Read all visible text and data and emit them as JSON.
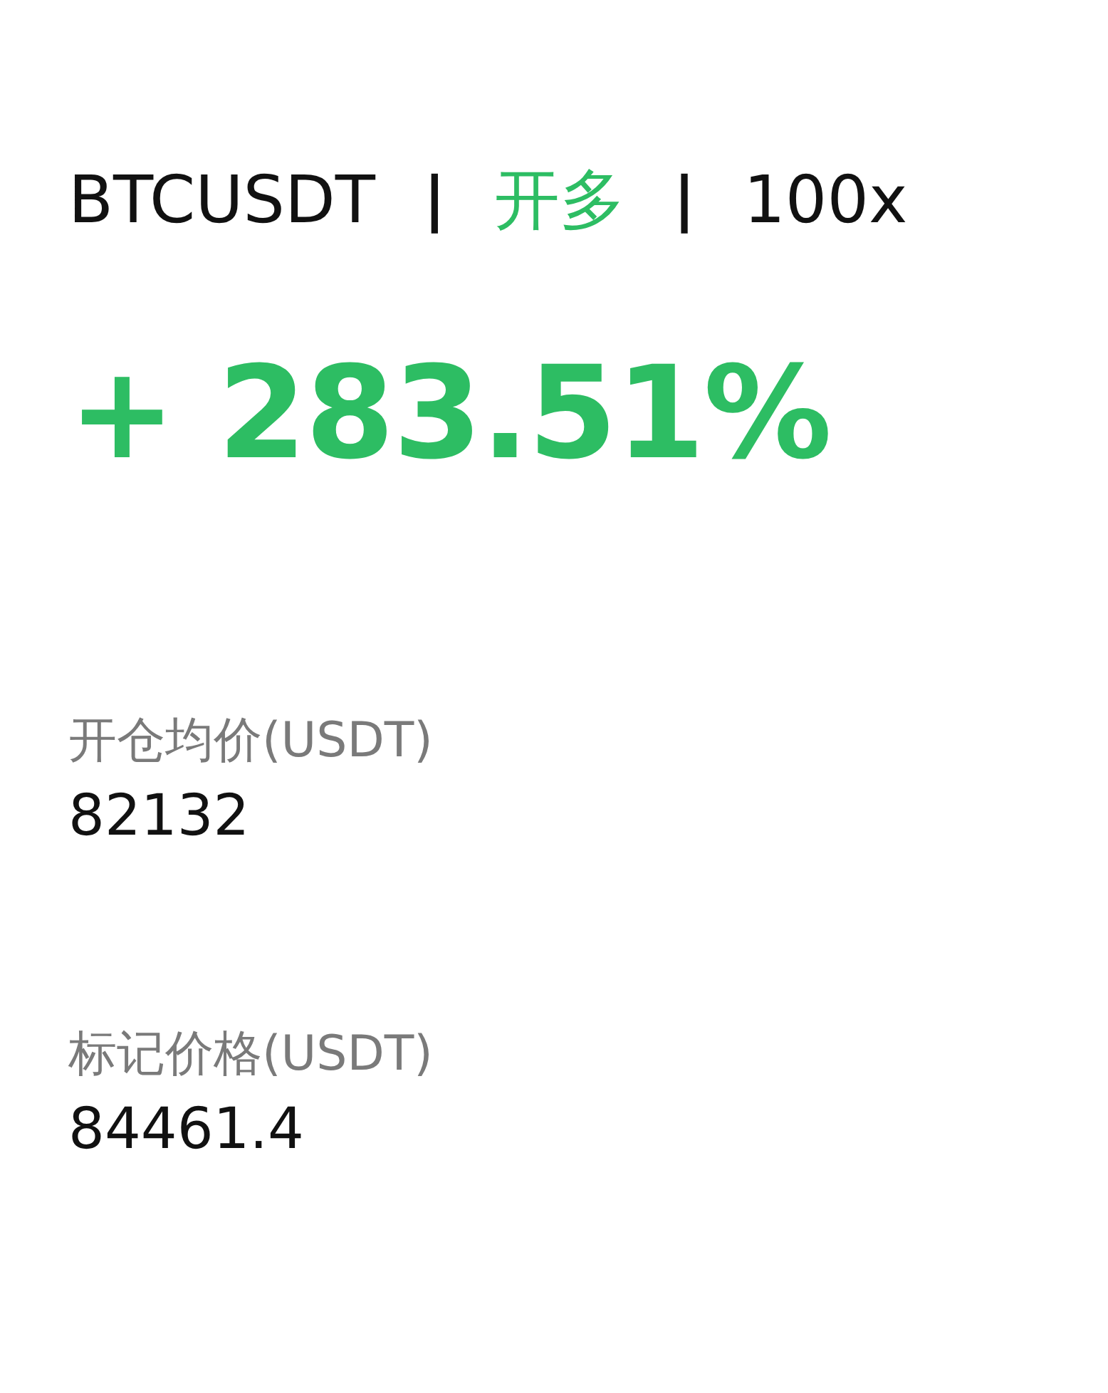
{
  "header": {
    "symbol": "BTCUSDT",
    "separators": [
      "|",
      "|"
    ],
    "side_label": "开多",
    "color": "#2dbd63",
    "leverage": "100x"
  },
  "pnl": {
    "text": "+ 283.51%",
    "color": "#2dbd63"
  },
  "stats": [
    {
      "label": "开仓均价(USDT)",
      "value": "82132"
    },
    {
      "label": "标记价格(USDT)",
      "value": "84461.4"
    }
  ]
}
